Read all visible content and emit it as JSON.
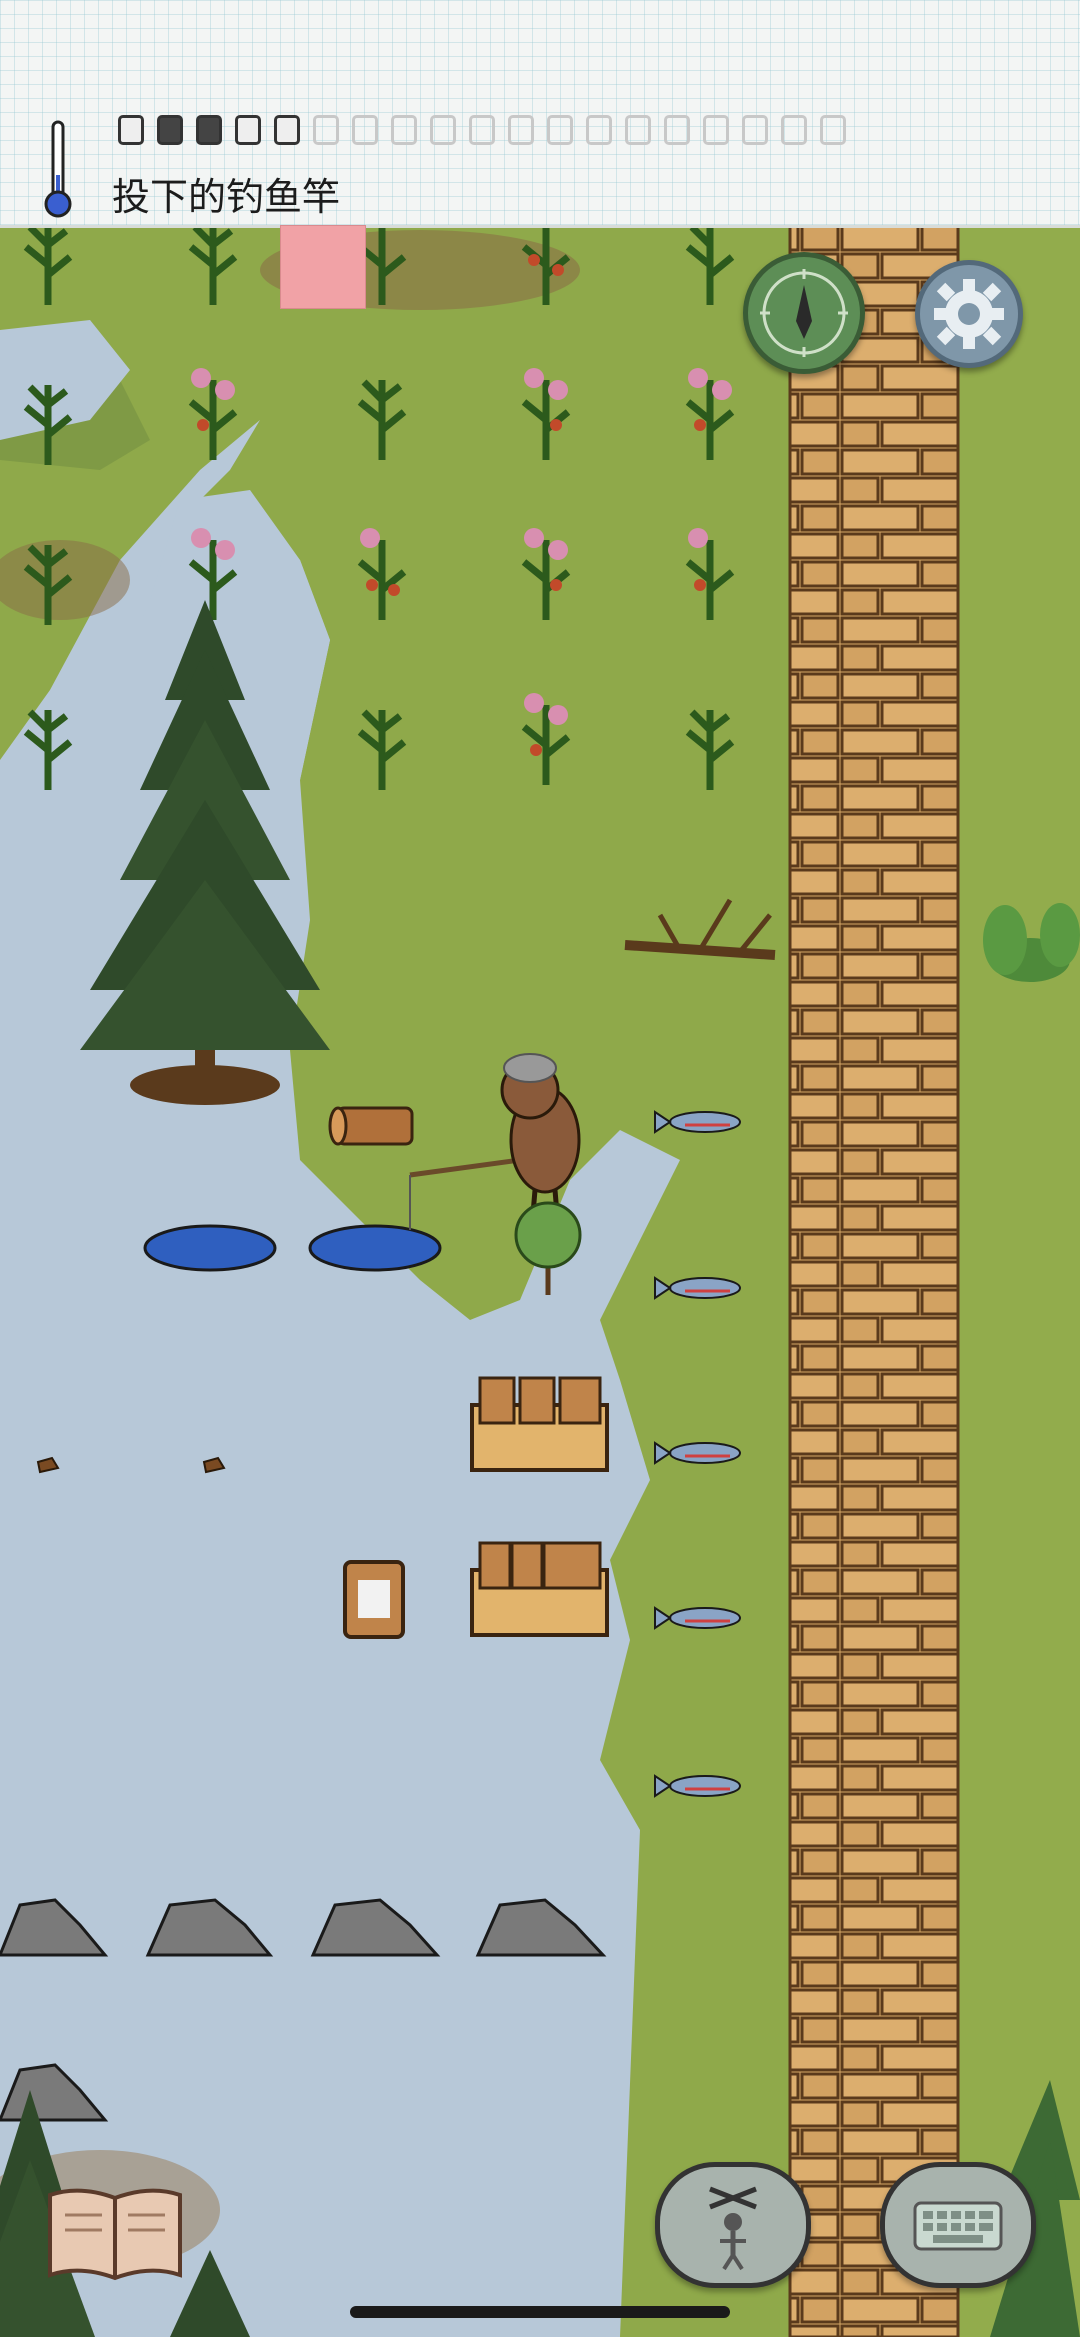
{
  "hud": {
    "held_item": "投下的钓鱼竿",
    "food_pips_filled": 5,
    "food_pips_total": 19
  },
  "colors": {
    "grass": "#8fa94a",
    "water": "#b7c8d8",
    "road": "#d6a866",
    "paper_tab": "#f1a2a6",
    "compass": "#5d8e56",
    "settings": "#7f97a9"
  },
  "icons": {
    "temperature": "thermometer-icon",
    "compass": "compass-icon",
    "settings": "gear-icon",
    "recipes": "book-icon",
    "emote": "puppet-icon",
    "chat": "keyboard-icon"
  }
}
